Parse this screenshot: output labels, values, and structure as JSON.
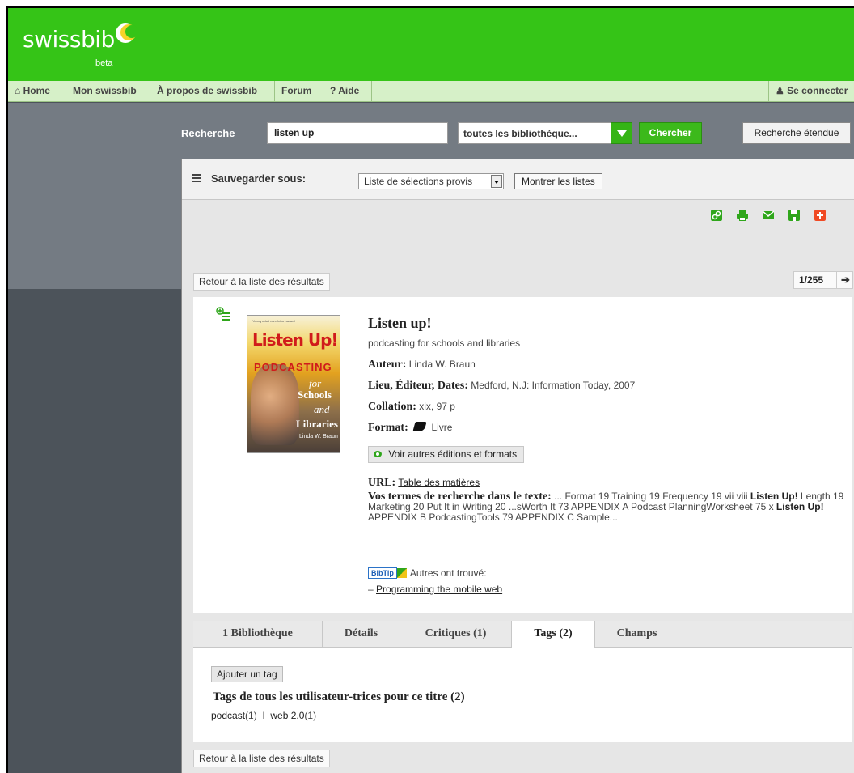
{
  "brand": {
    "name": "swissbib",
    "badge": "beta"
  },
  "nav": {
    "items": [
      {
        "icon": "home-icon",
        "label": "Home"
      },
      {
        "label": "Mon swissbib"
      },
      {
        "label": "À propos de swissbib"
      },
      {
        "label": "Forum"
      },
      {
        "icon": "help-icon",
        "label": "Aide"
      }
    ],
    "login": {
      "icon": "user-icon",
      "label": "Se connecter"
    }
  },
  "search": {
    "label": "Recherche",
    "query": "listen up",
    "scope": "toutes les bibliothèque...",
    "submit": "Chercher",
    "advanced": "Recherche étendue"
  },
  "savebar": {
    "label": "Sauvegarder sous:",
    "list_select": "Liste de sélections provis",
    "show_lists": "Montrer les listes"
  },
  "tools": [
    "link-icon",
    "print-icon",
    "email-icon",
    "save-icon",
    "add-icon"
  ],
  "navigation": {
    "back": "Retour à la liste des résultats",
    "pager": "1/255",
    "next_arrow": "➔"
  },
  "record": {
    "cover": {
      "top_text": "Young adult non-fiction award",
      "title": "Listen Up!",
      "sub": "PODCASTING",
      "for": "for",
      "schools": "Schools",
      "and": "and",
      "libraries": "Libraries",
      "author": "Linda W. Braun"
    },
    "title": "Listen up!",
    "subtitle": "podcasting for schools and libraries",
    "author_label": "Auteur:",
    "author": "Linda W. Braun",
    "publication_label": "Lieu, Éditeur, Dates:",
    "publication": "Medford, N.J: Information Today, 2007",
    "collation_label": "Collation:",
    "collation": "xix, 97 p",
    "format_label": "Format:",
    "format": "Livre",
    "editions_button": "Voir autres éditions et formats",
    "url_label": "URL:",
    "url_text": "Table des matières",
    "snippet_label": "Vos termes de recherche dans le texte:",
    "snippet_1": " ... Format 19 Training 19 Frequency 19 vii viii ",
    "snippet_b1": "Listen Up!",
    "snippet_2": " Length 19 Marketing 20 Put It in Writing 20 ...sWorth It 73 APPENDIX A Podcast PlanningWorksheet 75 x ",
    "snippet_b2": "Listen Up!",
    "snippet_3": " APPENDIX B PodcastingTools 79 APPENDIX C Sample...",
    "bibtip_logo": "BibTip",
    "bibtip_text": "Autres ont trouvé:",
    "bibtip_dash": "–",
    "bibtip_link": "Programming the mobile web"
  },
  "tabs": [
    {
      "label": "1 Bibliothèque"
    },
    {
      "label": "Détails"
    },
    {
      "label": "Critiques (1)"
    },
    {
      "label": "Tags (2)"
    },
    {
      "label": "Champs"
    }
  ],
  "tags": {
    "add_button": "Ajouter un tag",
    "heading": "Tags de tous les utilisateur-trices pour ce titre (2)",
    "items": [
      {
        "name": "podcast",
        "count": "(1)"
      },
      {
        "name": "web 2.0",
        "count": "(1)"
      }
    ],
    "separator": "I"
  },
  "colors": {
    "brand_green": "#35c417",
    "nav_green": "#d6f0c8",
    "band_gray": "#747b83",
    "dark_gray": "#4c535a"
  }
}
